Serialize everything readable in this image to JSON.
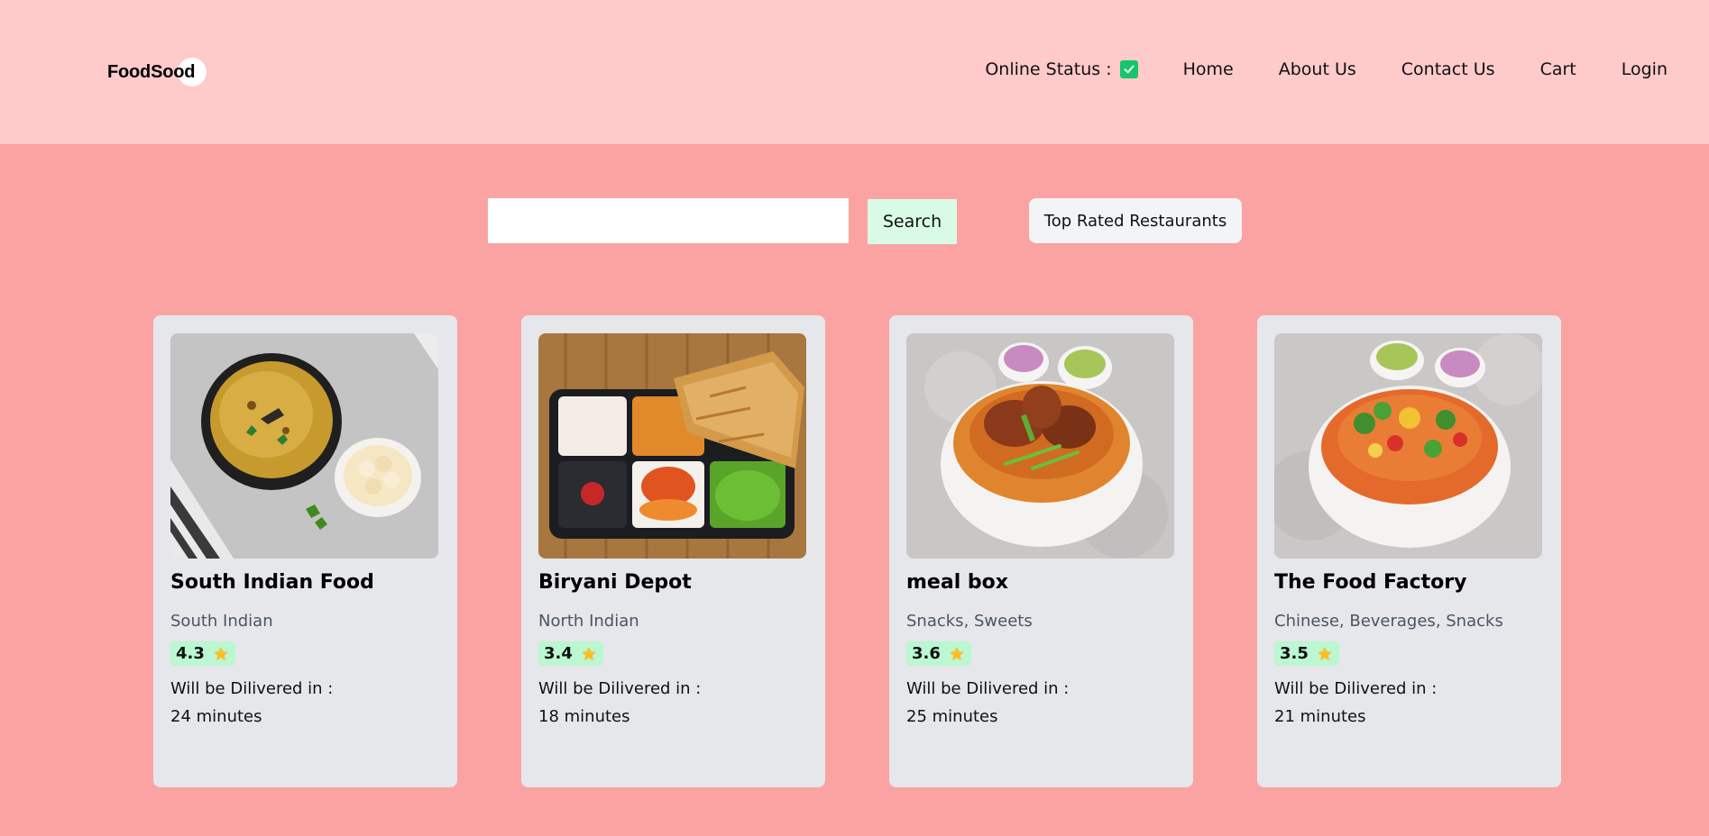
{
  "header": {
    "logo": "FoodSood",
    "online_status_label": "Online Status :",
    "nav": [
      {
        "label": "Home"
      },
      {
        "label": "About Us"
      },
      {
        "label": "Contact Us"
      },
      {
        "label": "Cart"
      },
      {
        "label": "Login"
      }
    ]
  },
  "search": {
    "value": "",
    "button_label": "Search"
  },
  "filter": {
    "top_rated_label": "Top Rated Restaurants"
  },
  "restaurants": [
    {
      "name": "South Indian Food",
      "cuisine": "South Indian",
      "rating": "4.3",
      "delivery_label": "Will be Dilivered in :",
      "delivery_time": "24 minutes"
    },
    {
      "name": "Biryani Depot",
      "cuisine": "North Indian",
      "rating": "3.4",
      "delivery_label": "Will be Dilivered in :",
      "delivery_time": "18 minutes"
    },
    {
      "name": "meal box",
      "cuisine": "Snacks, Sweets",
      "rating": "3.6",
      "delivery_label": "Will be Dilivered in :",
      "delivery_time": "25 minutes"
    },
    {
      "name": "The Food Factory",
      "cuisine": "Chinese, Beverages, Snacks",
      "rating": "3.5",
      "delivery_label": "Will be Dilivered in :",
      "delivery_time": "21 minutes"
    }
  ],
  "colors": {
    "page_bg": "#fba3a3",
    "header_bg": "#fecaca",
    "card_bg": "#e5e7eb",
    "rating_bg": "#bbf7d0",
    "online_check": "#16c66a",
    "star": "#fbbf24"
  },
  "icons": {
    "online_status": "checkbox-checked-icon",
    "rating": "star-icon"
  }
}
